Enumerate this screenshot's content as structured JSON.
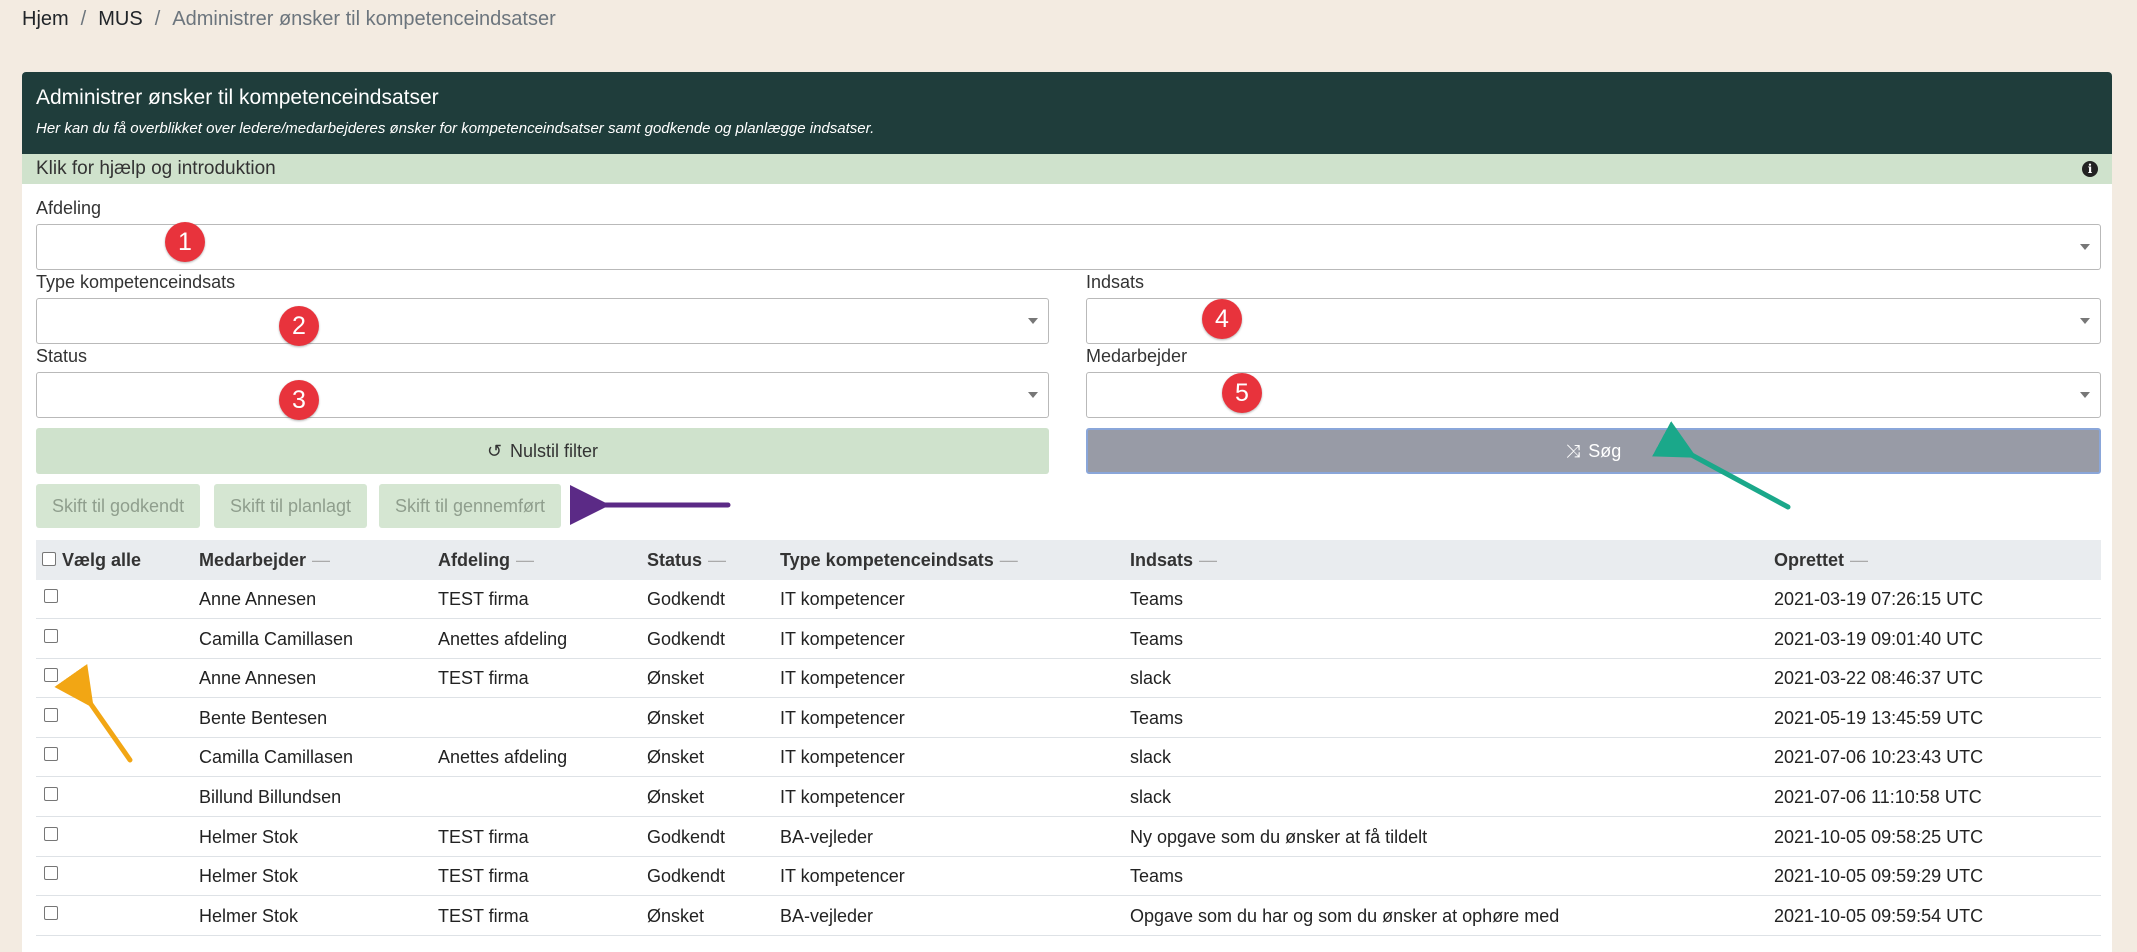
{
  "breadcrumb": {
    "items": [
      "Hjem",
      "MUS"
    ],
    "separator": "/",
    "active": "Administrer ønsker til kompetenceindsatser"
  },
  "panel": {
    "title": "Administrer ønsker til kompetenceindsatser",
    "subtitle": "Her kan du få overblikket over ledere/medarbejderes ønsker for kompetenceindsatser samt godkende og planlægge indsatser.",
    "help": "Klik for hjælp og introduktion",
    "help_icon": "info-circle-icon"
  },
  "filters": {
    "afdeling_label": "Afdeling",
    "type_label": "Type kompetenceindsats",
    "indsats_label": "Indsats",
    "status_label": "Status",
    "medarbejder_label": "Medarbejder"
  },
  "markers": [
    "1",
    "2",
    "3",
    "4",
    "5"
  ],
  "buttons": {
    "reset": "Nulstil filter",
    "reset_icon": "undo-icon",
    "search": "Søg",
    "search_icon": "shuffle-icon",
    "approve": "Skift til godkendt",
    "plan": "Skift til planlagt",
    "complete": "Skift til gennemført"
  },
  "table": {
    "select_all": "Vælg alle",
    "columns": [
      "Medarbejder",
      "Afdeling",
      "Status",
      "Type kompetenceindsats",
      "Indsats",
      "Oprettet"
    ],
    "sort_indicator": "—",
    "rows": [
      [
        "Anne Annesen",
        "TEST firma",
        "Godkendt",
        "IT kompetencer",
        "Teams",
        "2021-03-19 07:26:15 UTC"
      ],
      [
        "Camilla Camillasen",
        "Anettes afdeling",
        "Godkendt",
        "IT kompetencer",
        "Teams",
        "2021-03-19 09:01:40 UTC"
      ],
      [
        "Anne Annesen",
        "TEST firma",
        "Ønsket",
        "IT kompetencer",
        "slack",
        "2021-03-22 08:46:37 UTC"
      ],
      [
        "Bente Bentesen",
        "",
        "Ønsket",
        "IT kompetencer",
        "Teams",
        "2021-05-19 13:45:59 UTC"
      ],
      [
        "Camilla Camillasen",
        "Anettes afdeling",
        "Ønsket",
        "IT kompetencer",
        "slack",
        "2021-07-06 10:23:43 UTC"
      ],
      [
        "Billund Billundsen",
        "",
        "Ønsket",
        "IT kompetencer",
        "slack",
        "2021-07-06 11:10:58 UTC"
      ],
      [
        "Helmer Stok",
        "TEST firma",
        "Godkendt",
        "BA-vejleder",
        "Ny opgave som du ønsker at få tildelt",
        "2021-10-05 09:58:25 UTC"
      ],
      [
        "Helmer Stok",
        "TEST firma",
        "Godkendt",
        "IT kompetencer",
        "Teams",
        "2021-10-05 09:59:29 UTC"
      ],
      [
        "Helmer Stok",
        "TEST firma",
        "Ønsket",
        "BA-vejleder",
        "Opgave som du har og som du ønsker at ophøre med",
        "2021-10-05 09:59:54 UTC"
      ]
    ]
  },
  "colors": {
    "page_bg": "#f3ebe1",
    "header_bg": "#1f3d3b",
    "help_bg": "#cfe2cc",
    "marker": "#e8333c",
    "arrow_purple": "#5b2a86",
    "arrow_teal": "#1aa88a",
    "arrow_orange": "#f2a614"
  }
}
